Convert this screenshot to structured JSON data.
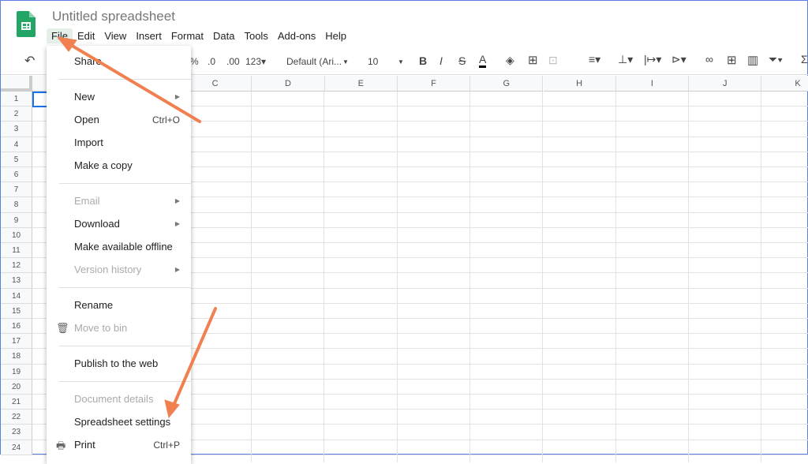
{
  "app": {
    "title": "Untitled spreadsheet",
    "logo": "google-sheets-logo"
  },
  "menubar": [
    "File",
    "Edit",
    "View",
    "Insert",
    "Format",
    "Data",
    "Tools",
    "Add-ons",
    "Help"
  ],
  "toolbar": {
    "percent": "%",
    "dec_decrease": ".0",
    "dec_increase": ".00",
    "format": "123▾",
    "font": "Default (Ari...",
    "font_size": "10",
    "bold": "B",
    "italic": "I",
    "strike": "S",
    "text_color": "A"
  },
  "columns": [
    "C",
    "D",
    "E",
    "F",
    "G",
    "H",
    "I",
    "J",
    "K"
  ],
  "rows": [
    "1",
    "2",
    "3",
    "4",
    "5",
    "6",
    "7",
    "8",
    "9",
    "10",
    "11",
    "12",
    "13",
    "14",
    "15",
    "16",
    "17",
    "18",
    "19",
    "20",
    "21",
    "22",
    "23",
    "24"
  ],
  "file_menu": [
    {
      "label": "Share"
    },
    {
      "label": "New",
      "submenu": true
    },
    {
      "label": "Open",
      "shortcut": "Ctrl+O"
    },
    {
      "label": "Import"
    },
    {
      "label": "Make a copy"
    },
    {
      "label": "Email",
      "submenu": true,
      "disabled": true
    },
    {
      "label": "Download",
      "submenu": true
    },
    {
      "label": "Make available offline"
    },
    {
      "label": "Version history",
      "submenu": true,
      "disabled": true
    },
    {
      "label": "Rename"
    },
    {
      "label": "Move to bin",
      "disabled": true,
      "icon": "trash-icon"
    },
    {
      "label": "Publish to the web"
    },
    {
      "label": "Document details",
      "disabled": true
    },
    {
      "label": "Spreadsheet settings"
    },
    {
      "label": "Print",
      "shortcut": "Ctrl+P",
      "icon": "printer-icon"
    }
  ],
  "annotation_color": "#f08050"
}
